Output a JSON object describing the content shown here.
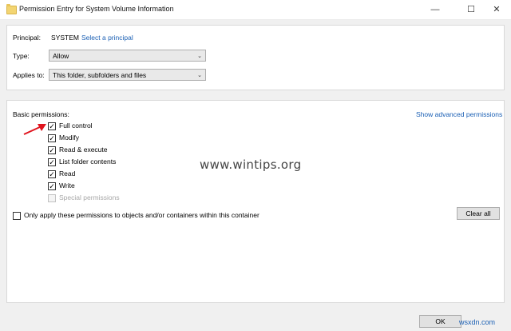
{
  "window": {
    "title": "Permission Entry for System Volume Information",
    "minimize_glyph": "—",
    "maximize_glyph": "☐",
    "close_glyph": "✕"
  },
  "principal": {
    "label": "Principal:",
    "value": "SYSTEM",
    "select_link": "Select a principal"
  },
  "type": {
    "label": "Type:",
    "selected": "Allow"
  },
  "applies_to": {
    "label": "Applies to:",
    "selected": "This folder, subfolders and files"
  },
  "basic": {
    "heading": "Basic permissions:",
    "advanced_link": "Show advanced permissions",
    "items": [
      {
        "label": "Full control",
        "checked": true,
        "disabled": false
      },
      {
        "label": "Modify",
        "checked": true,
        "disabled": false
      },
      {
        "label": "Read & execute",
        "checked": true,
        "disabled": false
      },
      {
        "label": "List folder contents",
        "checked": true,
        "disabled": false
      },
      {
        "label": "Read",
        "checked": true,
        "disabled": false
      },
      {
        "label": "Write",
        "checked": true,
        "disabled": false
      },
      {
        "label": "Special permissions",
        "checked": false,
        "disabled": true
      }
    ],
    "only_apply_label": "Only apply these permissions to objects and/or containers within this container",
    "clear_all_label": "Clear all"
  },
  "footer": {
    "ok_label": "OK"
  },
  "watermark": "www.wintips.org",
  "credit": "wsxdn.com",
  "colors": {
    "link": "#1a5fb4",
    "annotation_arrow": "#e0141e"
  },
  "icons": {
    "check": "✓",
    "dropdown": "⌄"
  }
}
